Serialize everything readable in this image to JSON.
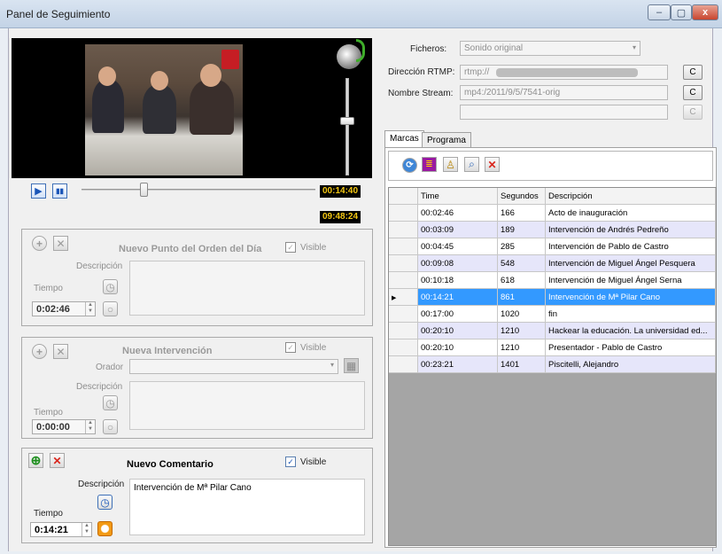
{
  "window": {
    "title": "Panel de Seguimiento",
    "minimize": "–",
    "maximize": "▢",
    "close": "x"
  },
  "player": {
    "current_time": "00:14:40",
    "total_time": "09:48:24",
    "play": "▶",
    "pause": "▮▮",
    "speaker_icon": "speaker-icon"
  },
  "punto": {
    "title": "Nuevo Punto del Orden del Día",
    "visible_label": "Visible",
    "visible_checked": true,
    "descripcion_label": "Descripción",
    "tiempo_label": "Tiempo",
    "tiempo_value": "0:02:46"
  },
  "intervencion": {
    "title": "Nueva Intervención",
    "visible_label": "Visible",
    "visible_checked": true,
    "orador_label": "Orador",
    "descripcion_label": "Descripción",
    "tiempo_label": "Tiempo",
    "tiempo_value": "0:00:00"
  },
  "comentario": {
    "title": "Nuevo Comentario",
    "visible_label": "Visible",
    "visible_checked": true,
    "descripcion_label": "Descripción",
    "descripcion_value": "Intervención de Mª Pilar Cano",
    "tiempo_label": "Tiempo",
    "tiempo_value": "0:14:21"
  },
  "stream": {
    "ficheros_label": "Ficheros:",
    "ficheros_value": "Sonido original",
    "rtmp_label": "Dirección RTMP:",
    "rtmp_value": "rtmp://",
    "stream_label": "Nombre Stream:",
    "stream_value": "mp4:/2011/9/5/7541-orig",
    "c_label": "C"
  },
  "tabs": [
    {
      "label": "Marcas"
    },
    {
      "label": "Programa"
    }
  ],
  "grid": {
    "columns": [
      "Time",
      "Segundos",
      "Descripción"
    ],
    "rows": [
      {
        "time": "00:02:46",
        "seg": "166",
        "desc": "Acto de inauguración"
      },
      {
        "time": "00:03:09",
        "seg": "189",
        "desc": "Intervención de Andrés Pedreño"
      },
      {
        "time": "00:04:45",
        "seg": "285",
        "desc": "Intervención de Pablo de Castro"
      },
      {
        "time": "00:09:08",
        "seg": "548",
        "desc": "Intervención de Miguel Ángel Pesquera"
      },
      {
        "time": "00:10:18",
        "seg": "618",
        "desc": "Intervención de Miguel Ángel Serna"
      },
      {
        "time": "00:14:21",
        "seg": "861",
        "desc": "Intervención de Mª Pilar Cano"
      },
      {
        "time": "00:17:00",
        "seg": "1020",
        "desc": "fin"
      },
      {
        "time": "00:20:10",
        "seg": "1210",
        "desc": "Hackear la educación. La universidad ed..."
      },
      {
        "time": "00:20:10",
        "seg": "1210",
        "desc": "Presentador - Pablo de Castro"
      },
      {
        "time": "00:23:21",
        "seg": "1401",
        "desc": "Piscitelli, Alejandro"
      }
    ],
    "selected_index": 5
  },
  "colors": {
    "selected_row": "#3399ff",
    "alt_row": "#e6e6fa",
    "time_text": "#f3c713"
  }
}
